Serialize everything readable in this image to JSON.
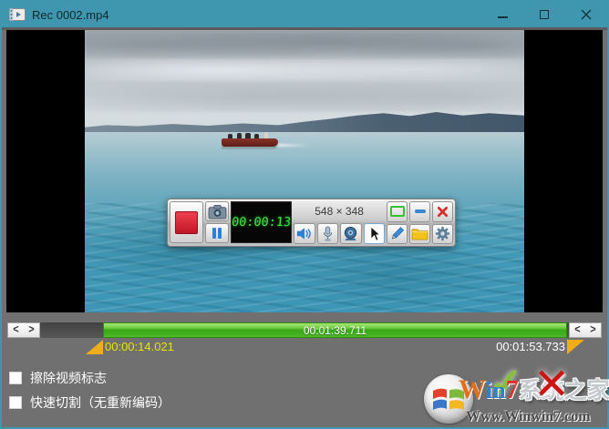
{
  "window": {
    "title": "Rec 0002.mp4"
  },
  "recorder": {
    "timer": "00:00:13",
    "capture_size": "548 × 348"
  },
  "timeline": {
    "current_time": "00:01:39.711",
    "start_time": "00:00:14.021",
    "end_time": "00:01:53.733"
  },
  "options": {
    "erase_logo_label": "擦除视频标志",
    "erase_logo_checked": false,
    "quick_cut_label": "快速切割（无重新编码）",
    "quick_cut_checked": false
  },
  "icons": {
    "prev": "<",
    "next": ">"
  },
  "watermark": {
    "letters": [
      "W",
      "i",
      "n",
      "7"
    ],
    "suffix": "系统之家",
    "url": "Www.Winwin7.com",
    "check_glyph": "✔",
    "cross_glyph": "✕"
  },
  "colors": {
    "titlebar": "#3e97ae",
    "selection_green": "#3fae1f",
    "marker_orange": "#efae17",
    "label_yellow": "#e9e400",
    "lcd_green": "#3fe43f"
  }
}
